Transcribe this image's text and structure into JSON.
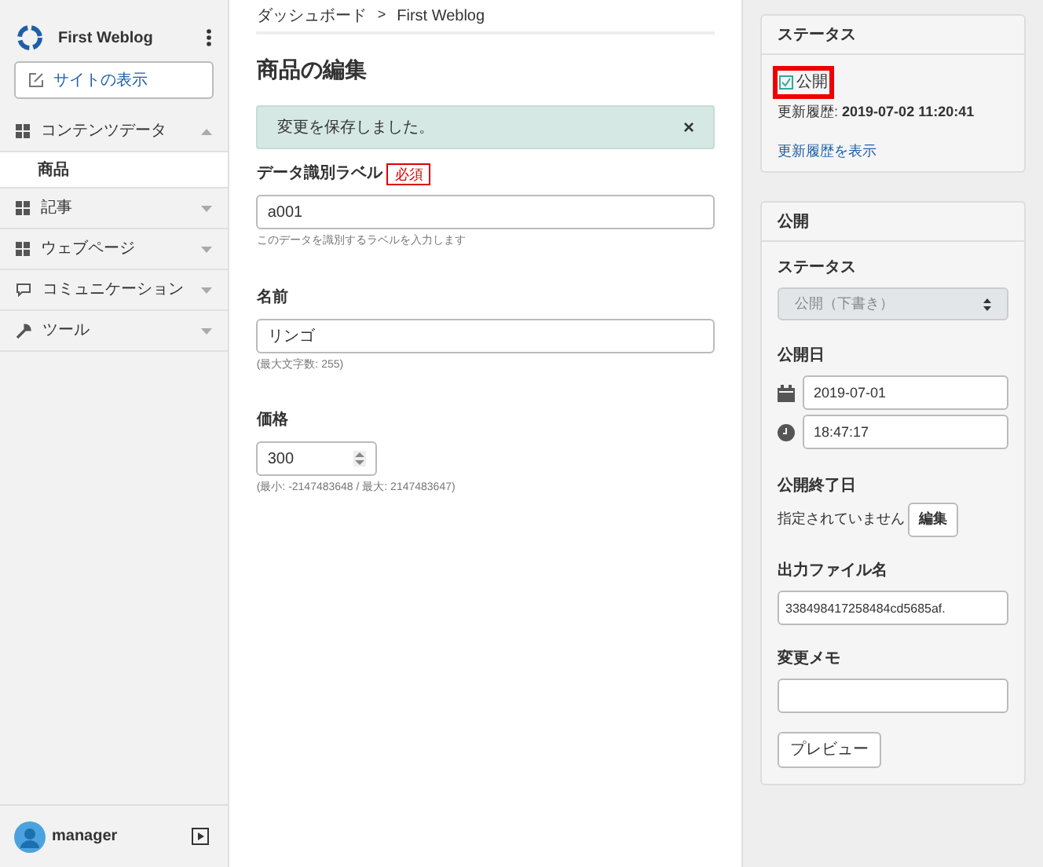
{
  "sidebar": {
    "site_name": "First Weblog",
    "view_site_button": "サイトの表示",
    "items": [
      {
        "label": "コンテンツデータ",
        "kind": "grid",
        "expanded": true,
        "children": [
          {
            "label": "商品",
            "selected": true
          }
        ]
      },
      {
        "label": "記事",
        "kind": "grid",
        "expanded": false
      },
      {
        "label": "ウェブページ",
        "kind": "grid",
        "expanded": false
      },
      {
        "label": "コミュニケーション",
        "kind": "chat",
        "expanded": false
      },
      {
        "label": "ツール",
        "kind": "wrench",
        "expanded": false
      }
    ],
    "user": "manager"
  },
  "breadcrumb": [
    "ダッシュボード",
    "First Weblog"
  ],
  "breadcrumb_separator": ">",
  "page_title": "商品の編集",
  "alert": {
    "message": "変更を保存しました。",
    "close": "×"
  },
  "fields": [
    {
      "kind": "text",
      "label": "データ識別ラベル",
      "required": "必須",
      "value": "a001",
      "help": "このデータを識別するラベルを入力します"
    },
    {
      "kind": "text",
      "label": "名前",
      "value": "リンゴ",
      "help": "(最大文字数: 255)"
    },
    {
      "kind": "number",
      "label": "価格",
      "value": "300",
      "help": "(最小: -2147483648 / 最大: 2147483647)"
    }
  ],
  "status_panel": {
    "title": "ステータス",
    "status": "公開",
    "updated_label": "更新履歴:",
    "updated": "2019-07-02 11:20:41",
    "history_link": "更新履歴を表示"
  },
  "publish_panel": {
    "title": "公開",
    "status_label": "ステータス",
    "status_value": "公開（下書き）",
    "date_label": "公開日",
    "date": "2019-07-01",
    "time": "18:47:17",
    "end_label": "公開終了日",
    "end_value": "指定されていません",
    "edit_button": "編集",
    "file_label": "出力ファイル名",
    "file_value": "338498417258484cd5685af.",
    "memo_label": "変更メモ",
    "preview_button": "プレビュー"
  }
}
